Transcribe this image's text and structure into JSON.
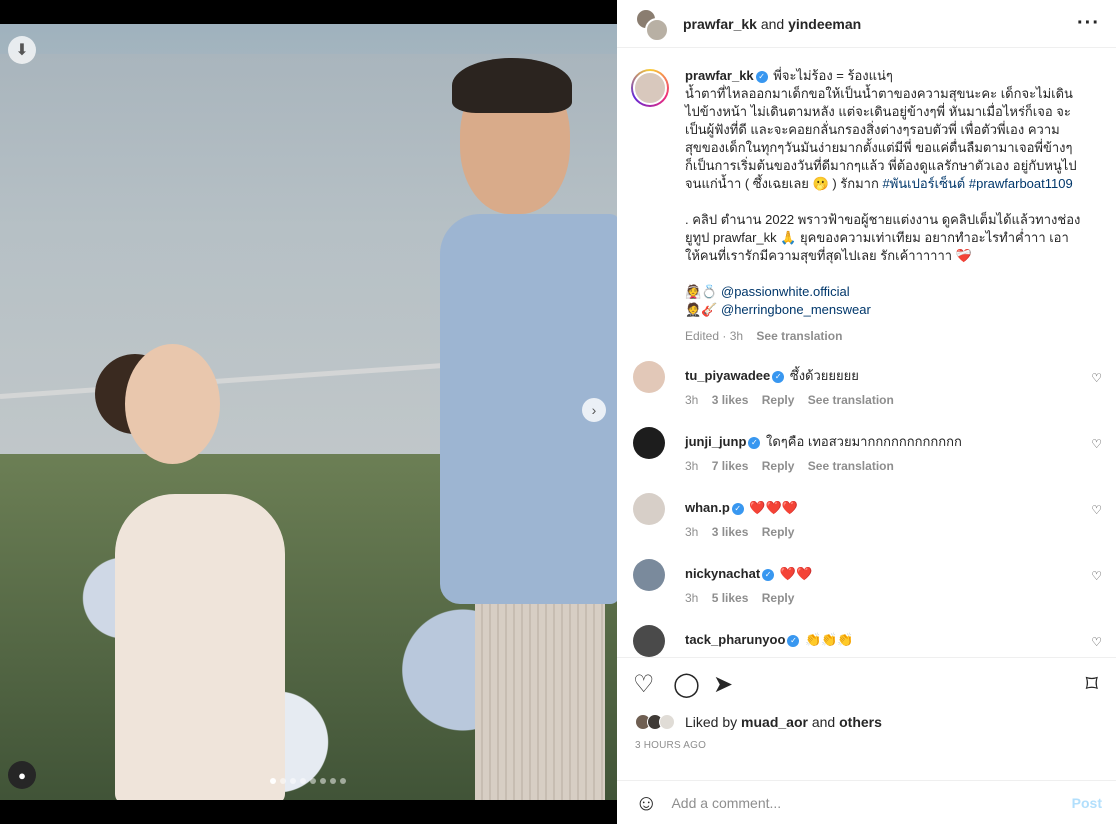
{
  "header": {
    "user1": "prawfar_kk",
    "and": "and",
    "user2": "yindeeman",
    "more_icon": "more-icon"
  },
  "caption": {
    "username": "prawfar_kk",
    "text": "พี่จะไม่ร้อง = ร้องแน่ๆ\nน้ำตาที่ไหลออกมาเด็กขอให้เป็นน้ำตาของความสุขนะคะ เด็กจะไม่เดิน\nไปข้างหน้า ไม่เดินตามหลัง แต่จะเดินอยู่ข้างๆพี่ หันมาเมื่อไหร่ก็เจอ จะ\nเป็นผู้ฟังที่ดี และจะคอยกลั่นกรองสิ่งต่างๆรอบตัวพี่ เพื่อตัวพี่เอง ความ\nสุขของเด็กในทุกๆวันมันง่ายมากตั้งแต่มีพี่ ขอแค่ตื่นลืมตามาเจอพี่ข้างๆ\nก็เป็นการเริ่มต้นของวันที่ดีมากๆแล้ว พี่ต้องดูแลรักษาตัวเอง อยู่กับหนูไป\nจนแก่น้ำา ( ซึ้งเฉยเลย 🫢 ) รักมาก ",
    "tag1": "#พันเปอร์เซ็นต์",
    "tag2": "#prawfarboat1109",
    "text2": ". คลิป ตำนาน 2022 พราวฟ้าขอผู้ชายแต่งงาน ดูคลิปเต็มได้แล้วทางช่อง\nยูทูป prawfar_kk 🙏 ยุคของความเท่าเทียม อยากทำอะไรทำค่ำาา เอา\nให้คนที่เรารักมีความสุขที่สุดไปเลย รักเค้าาาาาา ❤️‍🩹",
    "credit1_emoji": "👰💍",
    "credit1": "@passionwhite.official",
    "credit2_emoji": "🤵🎸",
    "credit2": "@herringbone_menswear",
    "edited": "Edited · 3h",
    "see_translation": "See translation"
  },
  "comments": [
    {
      "user": "tu_piyawadee",
      "text": "ซึ้งด้วยยยยย",
      "time": "3h",
      "likes": "3 likes",
      "reply": "Reply",
      "translate": "See translation",
      "color": "#e2c8b8"
    },
    {
      "user": "junji_junp",
      "text": "ใดๆคือ เทอสวยมากกกกกกกกกกกก",
      "time": "3h",
      "likes": "7 likes",
      "reply": "Reply",
      "translate": "See translation",
      "color": "#1d1d1d"
    },
    {
      "user": "whan.p",
      "text": "❤️❤️❤️",
      "time": "3h",
      "likes": "3 likes",
      "reply": "Reply",
      "translate": "",
      "color": "#d7cfc8"
    },
    {
      "user": "nickynachat",
      "text": "❤️❤️",
      "time": "3h",
      "likes": "5 likes",
      "reply": "Reply",
      "translate": "",
      "color": "#7a8a9c"
    },
    {
      "user": "tack_pharunyoo",
      "text": "👏👏👏",
      "time": "",
      "likes": "",
      "reply": "",
      "translate": "",
      "color": "#4a4a4a"
    }
  ],
  "likes": {
    "prefix": "Liked by",
    "user": "muad_aor",
    "and": "and",
    "others": "others"
  },
  "time_ago": "3 HOURS AGO",
  "comment_box": {
    "placeholder": "Add a comment...",
    "post": "Post"
  },
  "carousel": {
    "count": 8,
    "active": 0
  }
}
